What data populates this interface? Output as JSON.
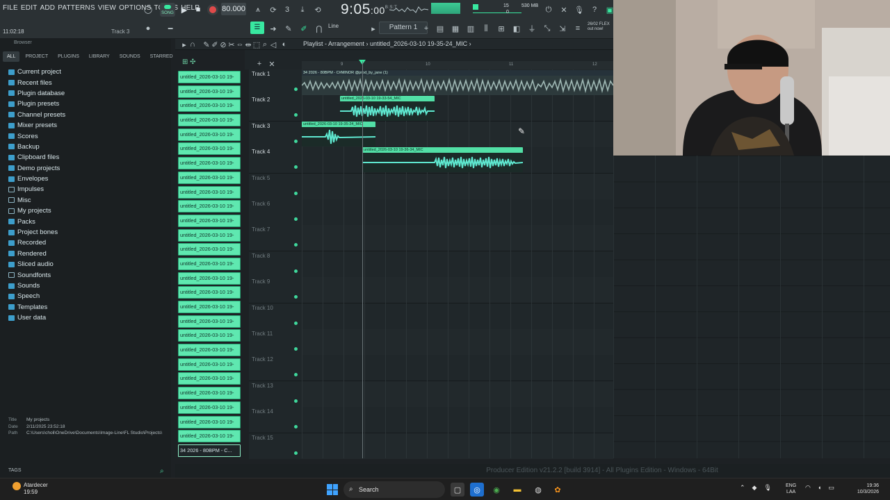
{
  "menu": [
    "FILE",
    "EDIT",
    "ADD",
    "PATTERNS",
    "VIEW",
    "OPTIONS",
    "TOOLS",
    "HELP"
  ],
  "transport": {
    "song_label": "SONG",
    "tempo": "80.000",
    "time": "9:05",
    "time_sub": ":00",
    "time_ms": "B:S:T",
    "cpu_value": "15",
    "mem_value": "530 MB",
    "mem_sub": "0"
  },
  "status_left": {
    "clock": "11:02:18",
    "hint": "Track 3"
  },
  "toolbar2": {
    "snap": "Line",
    "pattern": "Pattern 1",
    "news_date": "26/02",
    "news_brand": "FLEX",
    "news_text": "out now!"
  },
  "browser": {
    "title": "Browser",
    "tabs": [
      "ALL",
      "PROJECT",
      "PLUGINS",
      "LIBRARY",
      "SOUNDS",
      "STARRED"
    ],
    "items": [
      {
        "label": "Current project",
        "kind": "special"
      },
      {
        "label": "Recent files",
        "kind": "special"
      },
      {
        "label": "Plugin database",
        "kind": "special"
      },
      {
        "label": "Plugin presets",
        "kind": "special"
      },
      {
        "label": "Channel presets",
        "kind": "special"
      },
      {
        "label": "Mixer presets",
        "kind": "special"
      },
      {
        "label": "Scores",
        "kind": "special"
      },
      {
        "label": "Backup",
        "kind": "special"
      },
      {
        "label": "Clipboard files",
        "kind": "special"
      },
      {
        "label": "Demo projects",
        "kind": "special"
      },
      {
        "label": "Envelopes",
        "kind": "special"
      },
      {
        "label": "Impulses",
        "kind": "folder"
      },
      {
        "label": "Misc",
        "kind": "folder"
      },
      {
        "label": "My projects",
        "kind": "folder"
      },
      {
        "label": "Packs",
        "kind": "special"
      },
      {
        "label": "Project bones",
        "kind": "special"
      },
      {
        "label": "Recorded",
        "kind": "special"
      },
      {
        "label": "Rendered",
        "kind": "special"
      },
      {
        "label": "Sliced audio",
        "kind": "special"
      },
      {
        "label": "Soundfonts",
        "kind": "folder"
      },
      {
        "label": "Sounds",
        "kind": "special"
      },
      {
        "label": "Speech",
        "kind": "special"
      },
      {
        "label": "Templates",
        "kind": "special"
      },
      {
        "label": "User data",
        "kind": "special"
      }
    ],
    "info": {
      "title_k": "Title",
      "title_v": "My projects",
      "date_k": "Date",
      "date_v": "2/11/2025 23:52:18",
      "path_k": "Path",
      "path_v": "C:\\Users\\choli\\OneDrive\\Documents\\Image-Line\\FL Studio\\Projects\\"
    },
    "tags_label": "TAGS"
  },
  "cliplist": {
    "items": [
      "untitled_2026-03-10 19-",
      "untitled_2026-03-10 19-",
      "untitled_2026-03-10 19-",
      "untitled_2026-03-10 19-",
      "untitled_2026-03-10 19-",
      "untitled_2026-03-10 19-",
      "untitled_2026-03-10 19-",
      "untitled_2026-03-10 19-",
      "untitled_2026-03-10 19-",
      "untitled_2026-03-10 19-",
      "untitled_2026-03-10 19-",
      "untitled_2026-03-10 19-",
      "untitled_2026-03-10 19-",
      "untitled_2026-03-10 19-",
      "untitled_2026-03-10 19-",
      "untitled_2026-03-10 19-",
      "untitled_2026-03-10 19-",
      "untitled_2026-03-10 19-",
      "untitled_2026-03-10 19-",
      "untitled_2026-03-10 19-",
      "untitled_2026-03-10 19-",
      "untitled_2026-03-10 19-",
      "untitled_2026-03-10 19-",
      "untitled_2026-03-10 19-",
      "untitled_2026-03-10 19-",
      "untitled_2026-03-10 19-"
    ],
    "last": "34 2026 - 80BPM - C..."
  },
  "playlist": {
    "title": "Playlist - Arrangement",
    "file": "untitled_2026-03-10 19-35-24_MIC",
    "ruler": [
      "9",
      "10",
      "11",
      "12"
    ],
    "tracks": [
      "Track 1",
      "Track 2",
      "Track 3",
      "Track 4",
      "Track 5",
      "Track 6",
      "Track 7",
      "Track 8",
      "Track 9",
      "Track 10",
      "Track 11",
      "Track 12",
      "Track 13",
      "Track 14",
      "Track 15"
    ],
    "clips": {
      "c1": "34 2026 - 80BPM - C#MINOR @prod_by_jane (1)",
      "c2": "untitled_2026-03-10 19-33-54_MIC",
      "c3": "untitled_2026-03-10 19-35-24_MIC",
      "c4": "untitled_2026-03-10 19-36-34_MIC"
    }
  },
  "status_line": "Producer Edition v21.2.2 [build 3914] - All Plugins Edition - Windows - 64Bit",
  "taskbar": {
    "weather": "Atardecer",
    "weather_time": "19:59",
    "search": "Search",
    "lang1": "ENG",
    "lang2": "LAA",
    "time": "19:36",
    "date": "10/3/2026"
  },
  "colors": {
    "accent": "#38e8a0",
    "clip": "#5fe8b0",
    "bg": "#1d2124"
  }
}
